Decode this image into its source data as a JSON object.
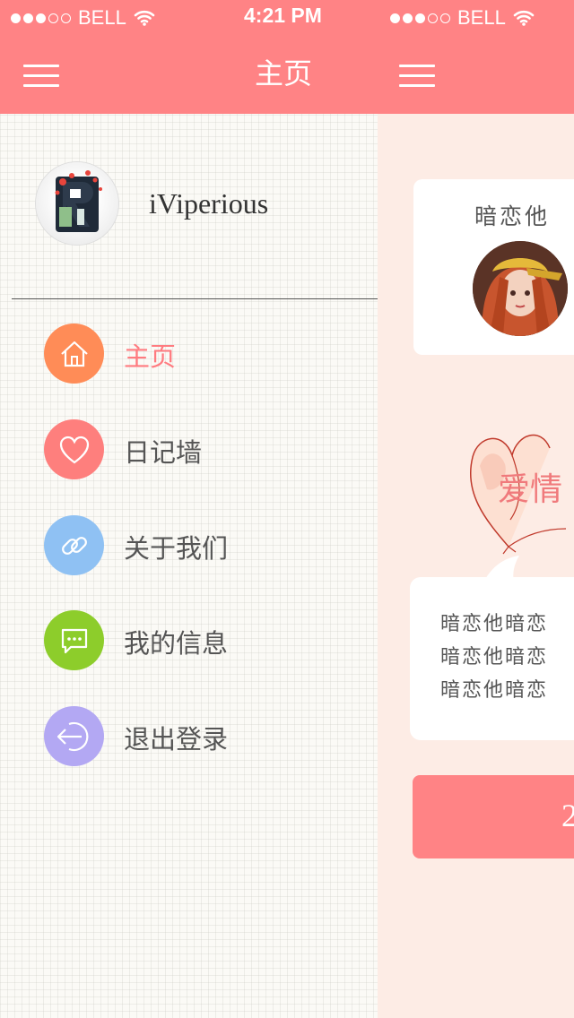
{
  "status_bar": {
    "carrier": "BELL",
    "time": "4:21 PM",
    "signal_bars": 3,
    "signal_total": 5
  },
  "nav": {
    "title": "主页"
  },
  "drawer": {
    "username": "iViperious",
    "menu_items": [
      {
        "label": "主页",
        "icon": "home-icon",
        "color": "#ff8c57",
        "active": true
      },
      {
        "label": "日记墙",
        "icon": "heart-icon",
        "color": "#fe7f7d",
        "active": false
      },
      {
        "label": "关于我们",
        "icon": "link-icon",
        "color": "#8fc1f3",
        "active": false
      },
      {
        "label": "我的信息",
        "icon": "message-icon",
        "color": "#8dcd2b",
        "active": false
      },
      {
        "label": "退出登录",
        "icon": "logout-icon",
        "color": "#b3a8f3",
        "active": false
      }
    ]
  },
  "main": {
    "card_title": "暗恋他",
    "love_text": "爱情",
    "text_lines": [
      "暗恋他暗恋",
      "暗恋他暗恋",
      "暗恋他暗恋"
    ],
    "button_text": "2"
  },
  "colors": {
    "header": "#ff8385",
    "active_text": "#ff7b80",
    "content_bg": "#fdece5"
  }
}
